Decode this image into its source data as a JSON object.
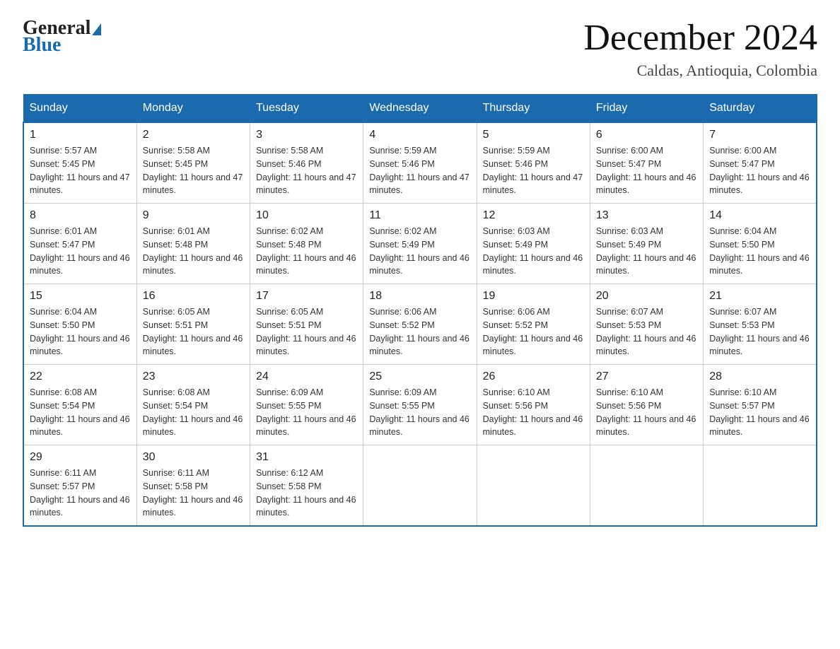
{
  "header": {
    "logo_general": "General",
    "logo_blue": "Blue",
    "title": "December 2024",
    "subtitle": "Caldas, Antioquia, Colombia"
  },
  "columns": [
    "Sunday",
    "Monday",
    "Tuesday",
    "Wednesday",
    "Thursday",
    "Friday",
    "Saturday"
  ],
  "weeks": [
    [
      {
        "day": "1",
        "sunrise": "5:57 AM",
        "sunset": "5:45 PM",
        "daylight": "11 hours and 47 minutes."
      },
      {
        "day": "2",
        "sunrise": "5:58 AM",
        "sunset": "5:45 PM",
        "daylight": "11 hours and 47 minutes."
      },
      {
        "day": "3",
        "sunrise": "5:58 AM",
        "sunset": "5:46 PM",
        "daylight": "11 hours and 47 minutes."
      },
      {
        "day": "4",
        "sunrise": "5:59 AM",
        "sunset": "5:46 PM",
        "daylight": "11 hours and 47 minutes."
      },
      {
        "day": "5",
        "sunrise": "5:59 AM",
        "sunset": "5:46 PM",
        "daylight": "11 hours and 47 minutes."
      },
      {
        "day": "6",
        "sunrise": "6:00 AM",
        "sunset": "5:47 PM",
        "daylight": "11 hours and 46 minutes."
      },
      {
        "day": "7",
        "sunrise": "6:00 AM",
        "sunset": "5:47 PM",
        "daylight": "11 hours and 46 minutes."
      }
    ],
    [
      {
        "day": "8",
        "sunrise": "6:01 AM",
        "sunset": "5:47 PM",
        "daylight": "11 hours and 46 minutes."
      },
      {
        "day": "9",
        "sunrise": "6:01 AM",
        "sunset": "5:48 PM",
        "daylight": "11 hours and 46 minutes."
      },
      {
        "day": "10",
        "sunrise": "6:02 AM",
        "sunset": "5:48 PM",
        "daylight": "11 hours and 46 minutes."
      },
      {
        "day": "11",
        "sunrise": "6:02 AM",
        "sunset": "5:49 PM",
        "daylight": "11 hours and 46 minutes."
      },
      {
        "day": "12",
        "sunrise": "6:03 AM",
        "sunset": "5:49 PM",
        "daylight": "11 hours and 46 minutes."
      },
      {
        "day": "13",
        "sunrise": "6:03 AM",
        "sunset": "5:49 PM",
        "daylight": "11 hours and 46 minutes."
      },
      {
        "day": "14",
        "sunrise": "6:04 AM",
        "sunset": "5:50 PM",
        "daylight": "11 hours and 46 minutes."
      }
    ],
    [
      {
        "day": "15",
        "sunrise": "6:04 AM",
        "sunset": "5:50 PM",
        "daylight": "11 hours and 46 minutes."
      },
      {
        "day": "16",
        "sunrise": "6:05 AM",
        "sunset": "5:51 PM",
        "daylight": "11 hours and 46 minutes."
      },
      {
        "day": "17",
        "sunrise": "6:05 AM",
        "sunset": "5:51 PM",
        "daylight": "11 hours and 46 minutes."
      },
      {
        "day": "18",
        "sunrise": "6:06 AM",
        "sunset": "5:52 PM",
        "daylight": "11 hours and 46 minutes."
      },
      {
        "day": "19",
        "sunrise": "6:06 AM",
        "sunset": "5:52 PM",
        "daylight": "11 hours and 46 minutes."
      },
      {
        "day": "20",
        "sunrise": "6:07 AM",
        "sunset": "5:53 PM",
        "daylight": "11 hours and 46 minutes."
      },
      {
        "day": "21",
        "sunrise": "6:07 AM",
        "sunset": "5:53 PM",
        "daylight": "11 hours and 46 minutes."
      }
    ],
    [
      {
        "day": "22",
        "sunrise": "6:08 AM",
        "sunset": "5:54 PM",
        "daylight": "11 hours and 46 minutes."
      },
      {
        "day": "23",
        "sunrise": "6:08 AM",
        "sunset": "5:54 PM",
        "daylight": "11 hours and 46 minutes."
      },
      {
        "day": "24",
        "sunrise": "6:09 AM",
        "sunset": "5:55 PM",
        "daylight": "11 hours and 46 minutes."
      },
      {
        "day": "25",
        "sunrise": "6:09 AM",
        "sunset": "5:55 PM",
        "daylight": "11 hours and 46 minutes."
      },
      {
        "day": "26",
        "sunrise": "6:10 AM",
        "sunset": "5:56 PM",
        "daylight": "11 hours and 46 minutes."
      },
      {
        "day": "27",
        "sunrise": "6:10 AM",
        "sunset": "5:56 PM",
        "daylight": "11 hours and 46 minutes."
      },
      {
        "day": "28",
        "sunrise": "6:10 AM",
        "sunset": "5:57 PM",
        "daylight": "11 hours and 46 minutes."
      }
    ],
    [
      {
        "day": "29",
        "sunrise": "6:11 AM",
        "sunset": "5:57 PM",
        "daylight": "11 hours and 46 minutes."
      },
      {
        "day": "30",
        "sunrise": "6:11 AM",
        "sunset": "5:58 PM",
        "daylight": "11 hours and 46 minutes."
      },
      {
        "day": "31",
        "sunrise": "6:12 AM",
        "sunset": "5:58 PM",
        "daylight": "11 hours and 46 minutes."
      },
      null,
      null,
      null,
      null
    ]
  ]
}
